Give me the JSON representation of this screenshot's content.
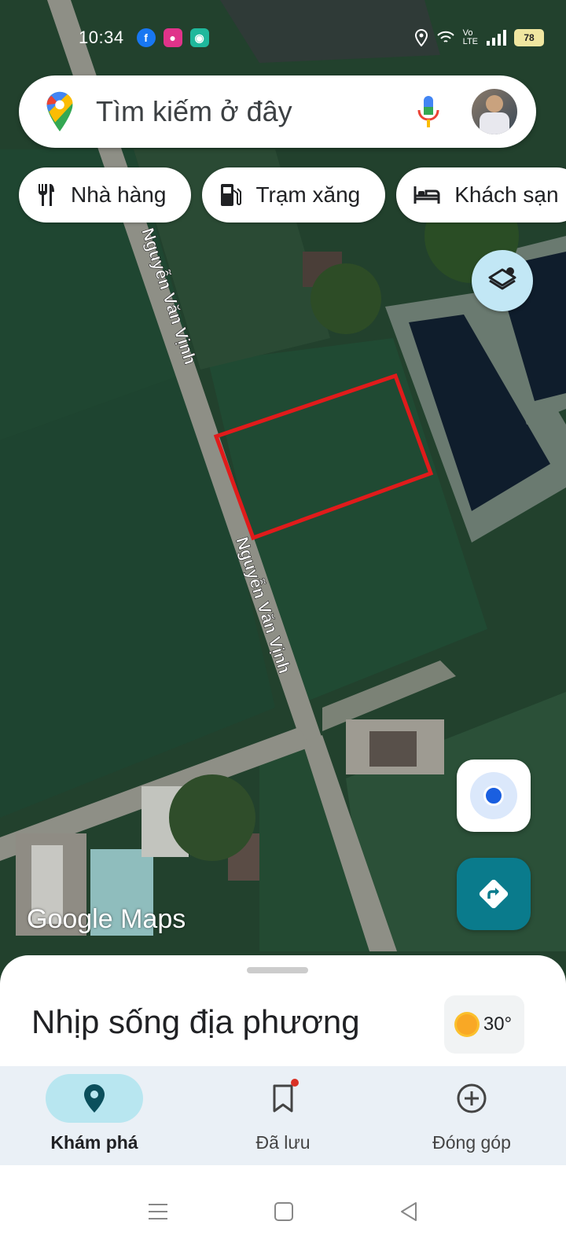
{
  "status_bar": {
    "time": "10:34",
    "battery": "78"
  },
  "search": {
    "placeholder": "Tìm kiếm ở đây"
  },
  "chips": [
    {
      "label": "Nhà hàng",
      "icon": "restaurant-icon"
    },
    {
      "label": "Trạm xăng",
      "icon": "gas-station-icon"
    },
    {
      "label": "Khách sạn",
      "icon": "hotel-icon"
    }
  ],
  "map": {
    "road_labels": [
      "Nguyễn Văn Vịnh",
      "Nguyễn Văn Vịnh"
    ],
    "watermark": "Google Maps",
    "highlight_color": "#e01b1b"
  },
  "sheet": {
    "title": "Nhịp sống địa phương",
    "weather": "30°"
  },
  "bottom_nav": [
    {
      "label": "Khám phá",
      "icon": "explore-pin-icon",
      "active": true
    },
    {
      "label": "Đã lưu",
      "icon": "bookmark-icon",
      "active": false
    },
    {
      "label": "Đóng góp",
      "icon": "add-circle-icon",
      "active": false
    }
  ],
  "colors": {
    "accent": "#0a7b8c",
    "active_pill": "#b8e6f0"
  }
}
